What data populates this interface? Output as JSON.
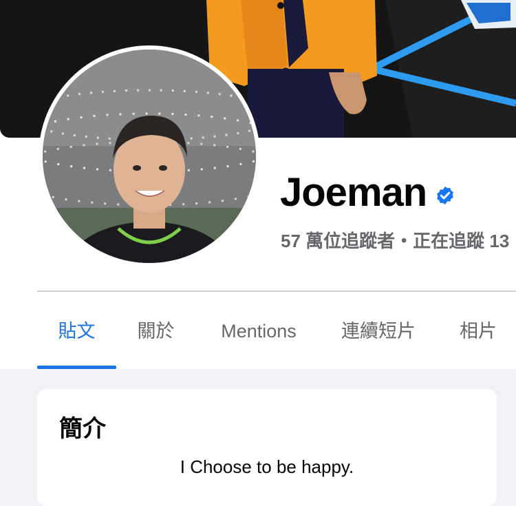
{
  "profile": {
    "name": "Joeman",
    "verified": true,
    "stats": "57 萬位追蹤者・正在追蹤 13"
  },
  "tabs": [
    {
      "label": "貼文",
      "active": true
    },
    {
      "label": "關於",
      "active": false
    },
    {
      "label": "Mentions",
      "active": false
    },
    {
      "label": "連續短片",
      "active": false
    },
    {
      "label": "相片",
      "active": false
    }
  ],
  "intro": {
    "title": "簡介",
    "bio": "I Choose to be happy."
  },
  "colors": {
    "accent": "#1b74e4",
    "verified_badge": "#1877f2",
    "page_bg": "#f0f2f5",
    "secondary_text": "#65676b"
  }
}
